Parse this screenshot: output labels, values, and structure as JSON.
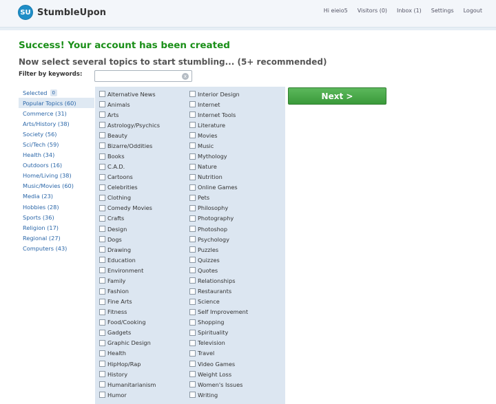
{
  "app": {
    "logo_badge": "SU",
    "name": "StumbleUpon"
  },
  "topnav": [
    "Hi eieio5",
    "Visitors (0)",
    "Inbox (1)",
    "Settings",
    "Logout"
  ],
  "main": {
    "success": "Success! Your account has been created",
    "subtitle": "Now select several topics to start stumbling... (5+ recommended)",
    "filter_label": "Filter by keywords:",
    "filter_value": "",
    "filter_clear": "x",
    "next_label": "Next >"
  },
  "categories": {
    "selected_label": "Selected",
    "selected_count": "0",
    "items": [
      "Popular Topics (60)",
      "Commerce (31)",
      "Arts/History (38)",
      "Society (56)",
      "Sci/Tech (59)",
      "Health (34)",
      "Outdoors (16)",
      "Home/Living (38)",
      "Music/Movies (60)",
      "Media (23)",
      "Hobbies (28)",
      "Sports (36)",
      "Religion (17)",
      "Regional (27)",
      "Computers (43)"
    ]
  },
  "topics": {
    "left": [
      "Alternative News",
      "Animals",
      "Arts",
      "Astrology/Psychics",
      "Beauty",
      "Bizarre/Oddities",
      "Books",
      "C.A.D.",
      "Cartoons",
      "Celebrities",
      "Clothing",
      "Comedy Movies",
      "Crafts",
      "Design",
      "Dogs",
      "Drawing",
      "Education",
      "Environment",
      "Family",
      "Fashion",
      "Fine Arts",
      "Fitness",
      "Food/Cooking",
      "Gadgets",
      "Graphic Design",
      "Health",
      "HipHop/Rap",
      "History",
      "Humanitarianism",
      "Humor"
    ],
    "right": [
      "Interior Design",
      "Internet",
      "Internet Tools",
      "Literature",
      "Movies",
      "Music",
      "Mythology",
      "Nature",
      "Nutrition",
      "Online Games",
      "Pets",
      "Philosophy",
      "Photography",
      "Photoshop",
      "Psychology",
      "Puzzles",
      "Quizzes",
      "Quotes",
      "Relationships",
      "Restaurants",
      "Science",
      "Self Improvement",
      "Shopping",
      "Spirituality",
      "Television",
      "Travel",
      "Video Games",
      "Weight Loss",
      "Women's Issues",
      "Writing"
    ]
  }
}
